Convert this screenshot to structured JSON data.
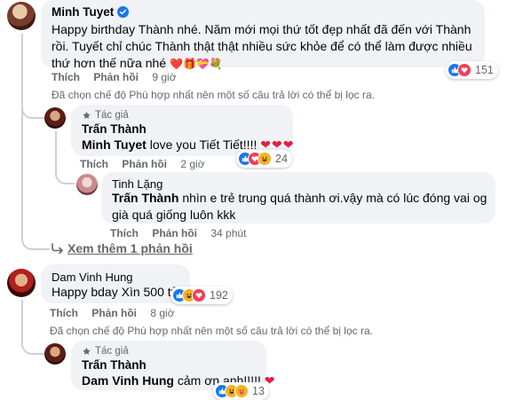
{
  "comment1": {
    "author": "Minh Tuyet",
    "text": "Happy birthday Thành nhé. Năm mới mọi thứ tốt đẹp nhất đã đến với Thành rồi. Tuyết chỉ chúc Thành thật thật nhiều sức khỏe để có thể làm được nhiều thứ hơn thế nữa nhé",
    "emoji": "❤️🎁💝💐",
    "like": "Thích",
    "reply": "Phản hồi",
    "time": "9 giờ",
    "reaction_count": "151"
  },
  "filter_note_1": "Đã chọn chế độ Phù hợp nhất nên một số câu trả lời có thể bị lọc ra.",
  "reply1": {
    "badge": "Tác giả",
    "author": "Trấn Thành",
    "mention": "Minh Tuyet",
    "text": " love you Tiết Tiết!!!! ",
    "hearts": "❤❤❤",
    "like": "Thích",
    "reply": "Phản hồi",
    "time": "2 giờ",
    "reaction_count": "24"
  },
  "reply2": {
    "author": "Tinh Lặng",
    "mention": "Trấn Thành",
    "text": " nhìn e trẻ trung quá thành ơi.vậy mà có lúc đóng vai og già quá giống luôn kkk",
    "like": "Thích",
    "reply": "Phản hồi",
    "time": "34 phút"
  },
  "see_more": "Xem thêm 1 phản hồi",
  "comment2": {
    "author": "Dam Vinh Hung",
    "text": "Happy bday Xìn 500 tỷ",
    "like": "Thích",
    "reply": "Phản hồi",
    "time": "8 giờ",
    "reaction_count": "192"
  },
  "filter_note_2": "Đã chọn chế độ Phù hợp nhất nên một số câu trả lời có thể bị lọc ra.",
  "reply3": {
    "badge": "Tác giả",
    "author": "Trấn Thành",
    "mention": "Dam Vinh Hung",
    "text": " cảm ơn anh!!!!! ",
    "hearts": "❤",
    "reaction_count": "13"
  },
  "colors": {
    "verified": "#1877f2",
    "like": "#1877f2",
    "love": "#f33e58",
    "haha": "#f7b125",
    "secondary_text": "#65676b",
    "bubble": "#f0f2f5"
  }
}
